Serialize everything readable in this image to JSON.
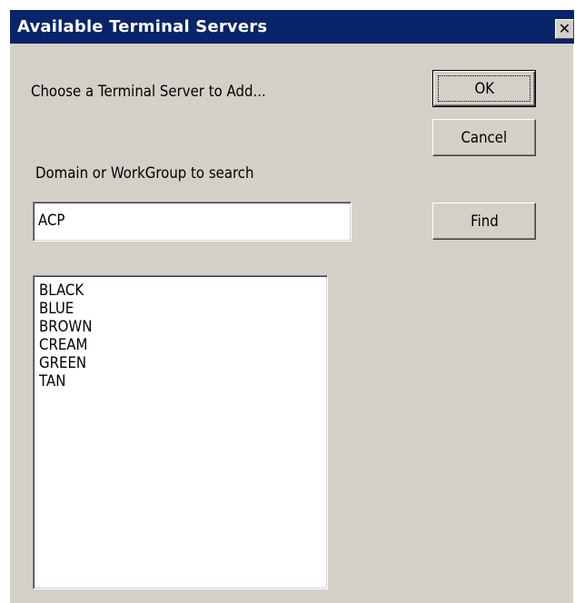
{
  "window": {
    "title": "Available Terminal Servers",
    "close_glyph": "✕"
  },
  "labels": {
    "choose": "Choose a Terminal Server to Add...",
    "domain": "Domain or WorkGroup to search"
  },
  "buttons": {
    "ok": "OK",
    "cancel": "Cancel",
    "find": "Find"
  },
  "domain_input": {
    "value": "ACP"
  },
  "servers": [
    "BLACK",
    "BLUE",
    "BROWN",
    "CREAM",
    "GREEN",
    "TAN"
  ],
  "colors": {
    "titlebar": "#0a246a",
    "face": "#d4d0c8"
  },
  "icons": {
    "close": "close-icon"
  }
}
